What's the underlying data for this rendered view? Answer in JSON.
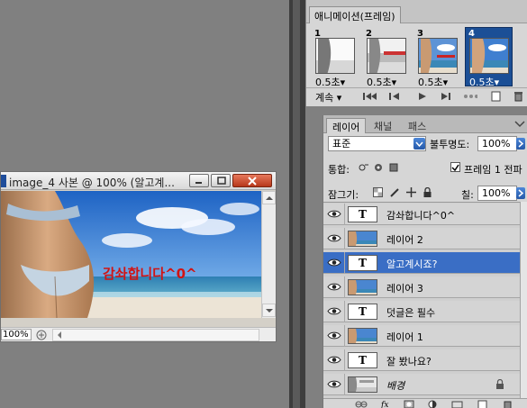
{
  "document": {
    "title": "image_4 사본 @ 100% (알고계...",
    "zoom": "100%",
    "overlay_text": "감솨합니다^0^"
  },
  "animation": {
    "tab_label": "애니메이션(프레임)",
    "frames": [
      {
        "num": "1",
        "delay": "0.5초▾",
        "selected": false
      },
      {
        "num": "2",
        "delay": "0.5초▾",
        "selected": false
      },
      {
        "num": "3",
        "delay": "0.5초▾",
        "selected": false
      },
      {
        "num": "4",
        "delay": "0.5초▾",
        "selected": true
      }
    ],
    "loop": "계속 ▾"
  },
  "layers": {
    "tabs": [
      "레이어",
      "채널",
      "패스"
    ],
    "blend_mode": "표준",
    "opacity_label": "불투명도:",
    "opacity": "100%",
    "unify_label": "통합:",
    "propagate_label": "프레임 1 전파",
    "lock_label": "잠그기:",
    "fill_label": "칠:",
    "fill": "100%",
    "items": [
      {
        "name": "감솨합니다^0^",
        "type": "text",
        "selected": false
      },
      {
        "name": "레이어 2",
        "type": "image",
        "selected": false
      },
      {
        "name": "알고계시죠?",
        "type": "text",
        "selected": true
      },
      {
        "name": "레이어 3",
        "type": "image",
        "selected": false
      },
      {
        "name": "덧글은 필수",
        "type": "text",
        "selected": false
      },
      {
        "name": "레이어 1",
        "type": "image",
        "selected": false
      },
      {
        "name": "잘 봤나요?",
        "type": "text",
        "selected": false
      },
      {
        "name": "배경",
        "type": "background",
        "selected": false
      }
    ],
    "text_thumb_glyph": "T"
  },
  "colors": {
    "selection_blue": "#3a6ec5",
    "overlay_red": "#d11313",
    "workspace": "#808080"
  }
}
